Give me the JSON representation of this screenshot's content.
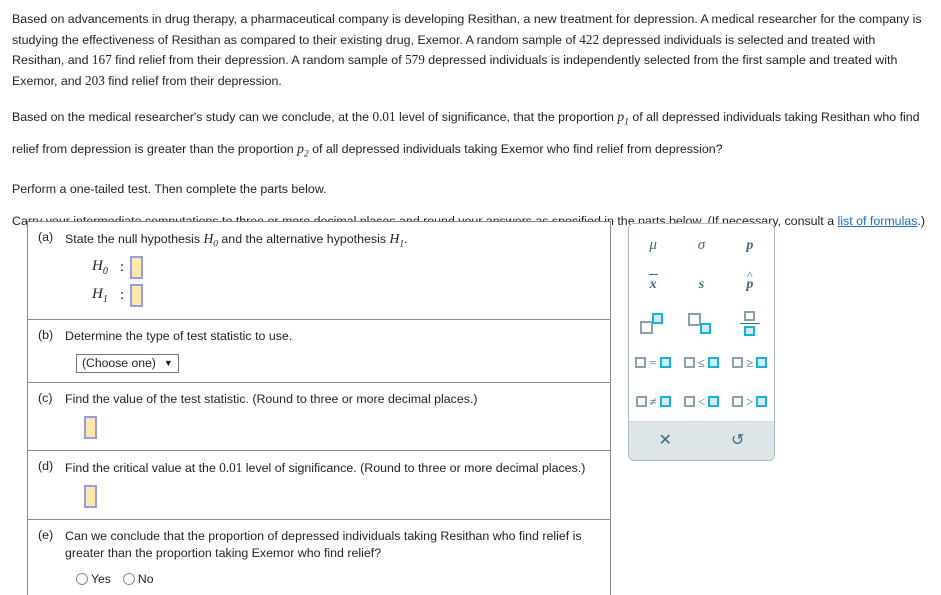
{
  "problem": {
    "intro_parts": [
      "Based on advancements in drug therapy, a pharmaceutical company is developing Resithan, a new treatment for depression. A medical researcher for the company is studying the effectiveness of Resithan as compared to their existing drug, Exemor. A random sample of ",
      "422",
      " depressed individuals is selected and treated with Resithan, and ",
      "167",
      " find relief from their depression. A random sample of ",
      "579",
      " depressed individuals is independently selected from the first sample and treated with Exemor, and ",
      "203",
      " find relief from their depression."
    ],
    "intro_full": "Based on advancements in drug therapy, a pharmaceutical company is developing Resithan, a new treatment for depression. A medical researcher for the company is studying the effectiveness of Resithan as compared to their existing drug, Exemor. A random sample of 422 depressed individuals is selected and treated with Resithan, and 167 find relief from their depression. A random sample of 579 depressed individuals is independently selected from the first sample and treated with Exemor, and 203 find relief from their depression.",
    "sample1_size": "422",
    "sample1_success": "167",
    "sample2_size": "579",
    "sample2_success": "203",
    "significance_level": "0.01",
    "drug_new": "Resithan",
    "drug_existing": "Exemor",
    "question_seg1": "Based on the medical researcher's study can we conclude, at the ",
    "question_seg2": " level of significance, that the proportion ",
    "question_p1": "p",
    "question_p1_sub": "1",
    "question_seg3": " of all depressed individuals taking Resithan who find relief from depression is greater than the proportion ",
    "question_p2": "p",
    "question_p2_sub": "2",
    "question_seg4": " of all depressed individuals taking Exemor who find relief from depression?",
    "perform_text": "Perform a one-tailed test. Then complete the parts below.",
    "carry_text_before": "Carry your intermediate computations to three or more decimal places and round your answers as specified in the parts below. (If necessary, consult a ",
    "carry_link": "list of formulas",
    "carry_text_after": ".)"
  },
  "parts": {
    "a": {
      "label": "(a)",
      "text_seg1": "State the null hypothesis ",
      "h0": "H",
      "h0_sub": "0",
      "text_seg2": " and the alternative hypothesis ",
      "h1": "H",
      "h1_sub": "1",
      "text_seg3": ".",
      "h0_name": "H",
      "h0_name_sub": "0",
      "h1_name": "H",
      "h1_name_sub": "1",
      "colon": ":",
      "h0_value": "",
      "h1_value": ""
    },
    "b": {
      "label": "(b)",
      "text": "Determine the type of test statistic to use.",
      "dropdown_value": "(Choose one)",
      "dropdown_caret": "▼"
    },
    "c": {
      "label": "(c)",
      "text": "Find the value of the test statistic. (Round to three or more decimal places.)",
      "value": ""
    },
    "d": {
      "label": "(d)",
      "text_seg1": "Find the critical value at the ",
      "text_level": "0.01",
      "text_seg2": " level of significance. (Round to three or more decimal places.)",
      "value": ""
    },
    "e": {
      "label": "(e)",
      "text": "Can we conclude that the proportion of depressed individuals taking Resithan who find relief is greater than the proportion taking Exemor who find relief?",
      "options": [
        "Yes",
        "No"
      ],
      "selected": ""
    }
  },
  "palette": {
    "symbols": [
      {
        "name": "mu",
        "display": "μ"
      },
      {
        "name": "sigma",
        "display": "σ"
      },
      {
        "name": "p",
        "display": "p"
      },
      {
        "name": "x-bar",
        "display": "x"
      },
      {
        "name": "s",
        "display": "s"
      },
      {
        "name": "p-hat",
        "display": "p"
      }
    ],
    "structures": [
      {
        "name": "superscript",
        "display": "□□"
      },
      {
        "name": "subscript",
        "display": "□□"
      },
      {
        "name": "fraction",
        "display": "□/□"
      }
    ],
    "operators": [
      {
        "name": "equals",
        "op": "="
      },
      {
        "name": "less-than-or-equal",
        "op": "≤"
      },
      {
        "name": "greater-than-or-equal",
        "op": "≥"
      },
      {
        "name": "not-equal",
        "op": "≠"
      },
      {
        "name": "less-than",
        "op": "<"
      },
      {
        "name": "greater-than",
        "op": ">"
      }
    ],
    "footer": {
      "clear": "✕",
      "undo": "↺"
    }
  },
  "colors": {
    "link": "#1a6ecc",
    "input_fill": "#fbe9ab",
    "input_border": "#9a9ae8",
    "palette_accent": "#17b3d4",
    "palette_text": "#3d6b80",
    "palette_footer": "#dde5e7"
  }
}
